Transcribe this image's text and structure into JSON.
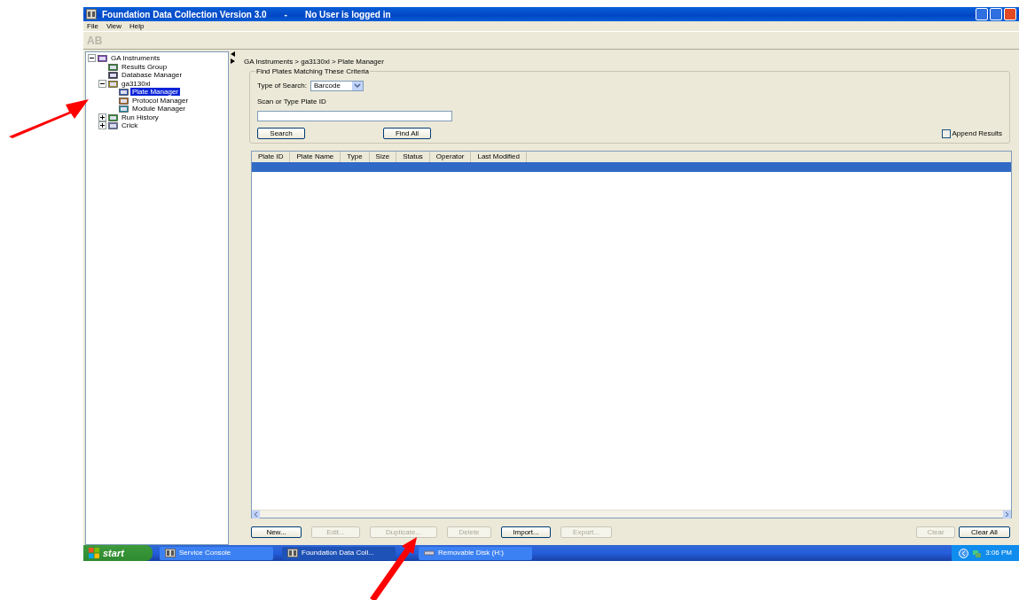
{
  "window": {
    "title": "Foundation Data Collection Version 3.0",
    "separator": "-",
    "user_status": "No User is logged in"
  },
  "menu": [
    "File",
    "View",
    "Help"
  ],
  "toolbar": {
    "logo": "AB"
  },
  "tree": [
    {
      "label": "GA Instruments",
      "expanded": true,
      "selected": false,
      "children": [
        {
          "label": "Results Group",
          "selected": false
        },
        {
          "label": "Database Manager",
          "selected": false
        },
        {
          "label": "ga3130xl",
          "expanded": true,
          "selected": false,
          "children": [
            {
              "label": "Plate Manager",
              "selected": true
            },
            {
              "label": "Protocol Manager",
              "selected": false
            },
            {
              "label": "Module Manager",
              "selected": false
            }
          ]
        },
        {
          "label": "Run History",
          "expanded": false,
          "selected": false
        },
        {
          "label": "Crick",
          "expanded": false,
          "selected": false
        }
      ]
    }
  ],
  "breadcrumb": "GA Instruments > ga3130xl > Plate Manager",
  "criteria": {
    "legend": "Find Plates Matching These Criteria",
    "type_label": "Type of Search:",
    "type_value": "Barcode",
    "id_label": "Scan or Type Plate ID",
    "buttons": [
      "Search",
      "Find All"
    ],
    "append": {
      "label": "Append Results",
      "checked": false
    }
  },
  "table": {
    "columns": [
      "Plate ID",
      "Plate Name",
      "Type",
      "Size",
      "Status",
      "Operator",
      "Last Modified"
    ],
    "rows": [
      {
        "selected": true
      }
    ]
  },
  "buttons": [
    {
      "label": "New...",
      "disabled": false
    },
    {
      "label": "Edit...",
      "disabled": true
    },
    {
      "label": "Duplicate...",
      "disabled": true
    },
    {
      "label": "Delete",
      "disabled": true
    },
    {
      "label": "Import...",
      "disabled": false
    },
    {
      "label": "Export...",
      "disabled": true
    }
  ],
  "right_buttons": [
    {
      "label": "Clear",
      "disabled": true
    },
    {
      "label": "Clear All",
      "disabled": false
    }
  ],
  "taskbar": {
    "start": "start",
    "items": [
      {
        "label": "Service Console",
        "selected": false
      },
      {
        "label": "Foundation Data Coll...",
        "selected": true
      },
      {
        "label": "Removable Disk (H:)",
        "selected": false
      }
    ],
    "clock": "3:06 PM"
  }
}
